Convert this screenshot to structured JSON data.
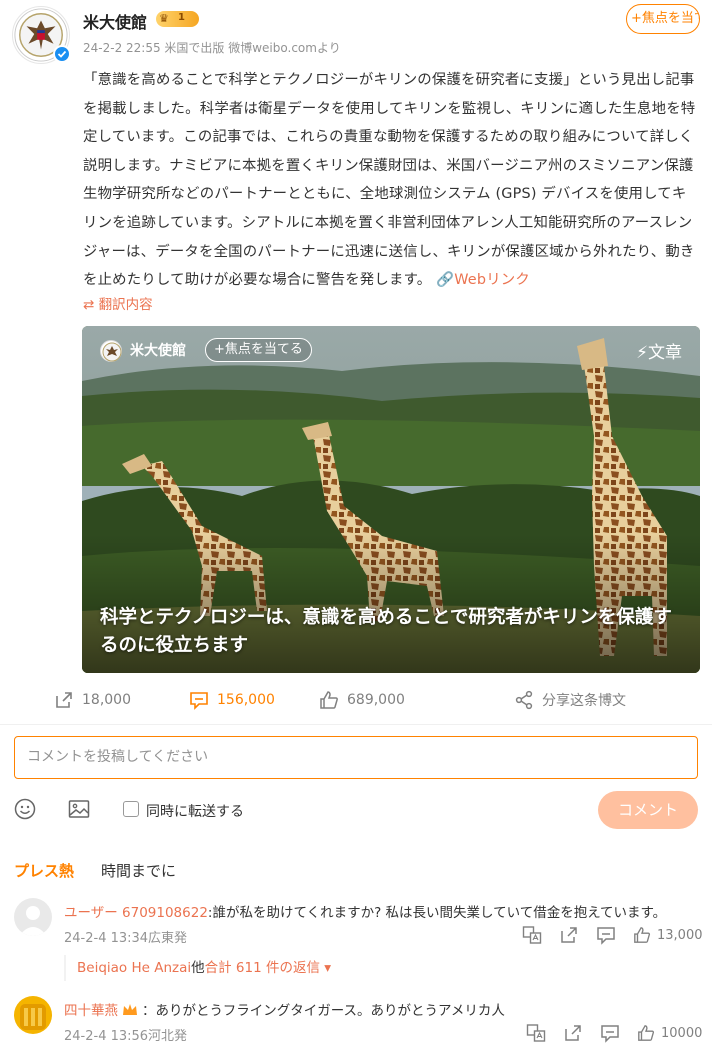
{
  "post": {
    "author": "米大使館",
    "vip_level": "1",
    "meta": "24-2-2 22:55  米国で出版  微博weibo.comより",
    "follow_label": "+焦点を当て",
    "text": "「意識を高めることで科学とテクノロジーがキリンの保護を研究者に支援」という見出し記事を掲載しました。科学者は衛星データを使用してキリンを監視し、キリンに適した生息地を特定しています。この記事では、これらの貴重な動物を保護するための取り組みについて詳しく説明します。ナミビアに本拠を置くキリン保護財団は、米国バージニア州のスミソニアン保護生物学研究所などのパートナーとともに、全地球測位システム (GPS) デバイスを使用してキリンを追跡しています。シアトルに本拠を置く非営利団体アレン人工知能研究所のアースレンジャーは、データを全国のパートナーに迅速に送信し、キリンが保護区域から外れたり、動きを止めたりして助けが必要な場合に警告を発します。",
    "weblink_label": "Webリンク",
    "translate_label": "翻訳内容"
  },
  "card": {
    "author": "米大使館",
    "follow_label": "+焦点を当てる",
    "type_label": "文章",
    "title": "科学とテクノロジーは、意識を高めることで研究者がキリンを保護するのに役立ちます"
  },
  "actions": {
    "repost_count": "18,000",
    "comment_count": "156,000",
    "like_count": "689,000",
    "share_label": "分享这条博文"
  },
  "composer": {
    "placeholder": "コメントを投稿してください",
    "repost_label": "同時に転送する",
    "submit_label": "コメント"
  },
  "sort_tabs": {
    "hot": "プレス熱",
    "time": "時間までに"
  },
  "comments": [
    {
      "user": "ユーザー 6709108622",
      "text": ":誰が私を助けてくれますか? 私は長い間失業していて借金を抱えています。",
      "meta": "24-2-4 13:34広東発",
      "likes": "13,000",
      "replies_name": "Beiqiao He Anzai",
      "replies_mid": "他",
      "replies_count": "合計 611 件の返信"
    },
    {
      "user": "四十華燕",
      "text": "：ありがとうフライングタイガース。ありがとうアメリカ人",
      "meta": "24-2-4 13:56河北発",
      "likes": "10000"
    }
  ],
  "colors": {
    "accent": "#ff8200",
    "link": "#eb7350",
    "muted": "#939393",
    "verified": "#1a8ff2"
  }
}
